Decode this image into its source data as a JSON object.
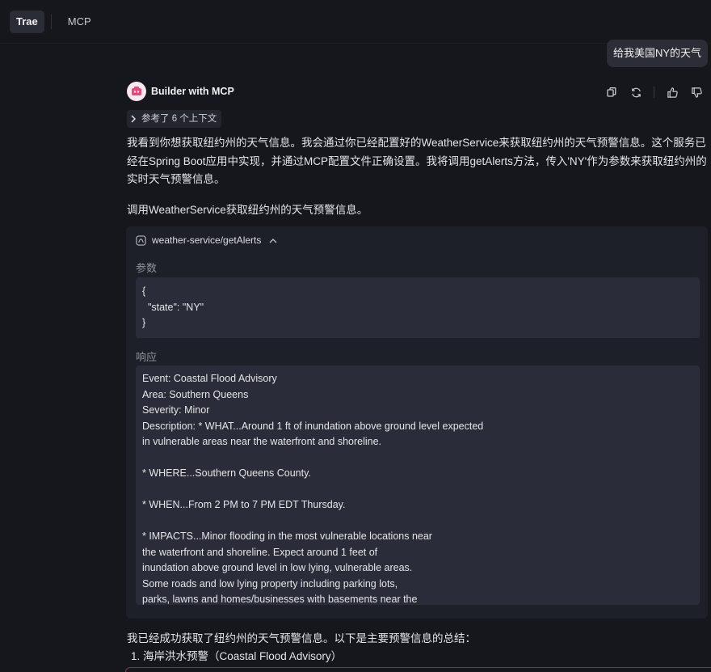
{
  "tabs": [
    {
      "label": "Trae",
      "active": true
    },
    {
      "label": "MCP",
      "active": false
    }
  ],
  "user_message": "给我美国NY的天气",
  "bot": {
    "name": "Builder with MCP",
    "avatar_icon": "builder-avatar-icon"
  },
  "actions": [
    "copy-icon",
    "refresh-icon",
    "thumbs-up-icon",
    "thumbs-down-icon"
  ],
  "context_chip": "参考了 6 个上下文",
  "paragraphs": {
    "intro": "我看到你想获取纽约州的天气信息。我会通过你已经配置好的WeatherService来获取纽约州的天气预警信息。这个服务已经在Spring Boot应用中实现，并通过MCP配置文件正确设置。我将调用getAlerts方法，传入'NY'作为参数来获取纽约州的实时天气预警信息。",
    "call": "调用WeatherService获取纽约州的天气预警信息。",
    "summary": "我已经成功获取了纽约州的天气预警信息。以下是主要预警信息的总结：",
    "list_item_1": "1. 海岸洪水预警（Coastal Flood Advisory）"
  },
  "tool_call": {
    "name": "weather-service/getAlerts",
    "params_label": "参数",
    "params_lines": [
      "{",
      "  \"state\": \"NY\"",
      "}"
    ],
    "response_label": "响应",
    "response_lines": [
      "Event: Coastal Flood Advisory",
      "Area: Southern Queens",
      "Severity: Minor",
      "Description: * WHAT...Around 1 ft of inundation above ground level expected",
      "in vulnerable areas near the waterfront and shoreline.",
      "",
      "* WHERE...Southern Queens County.",
      "",
      "* WHEN...From 2 PM to 7 PM EDT Thursday.",
      "",
      "* IMPACTS...Minor flooding in the most vulnerable locations near",
      "the waterfront and shoreline. Expect around 1 feet of",
      "inundation above ground level in low lying, vulnerable areas.",
      "Some roads and low lying property including parking lots,",
      "parks, lawns and homes/businesses with basements near the"
    ]
  }
}
